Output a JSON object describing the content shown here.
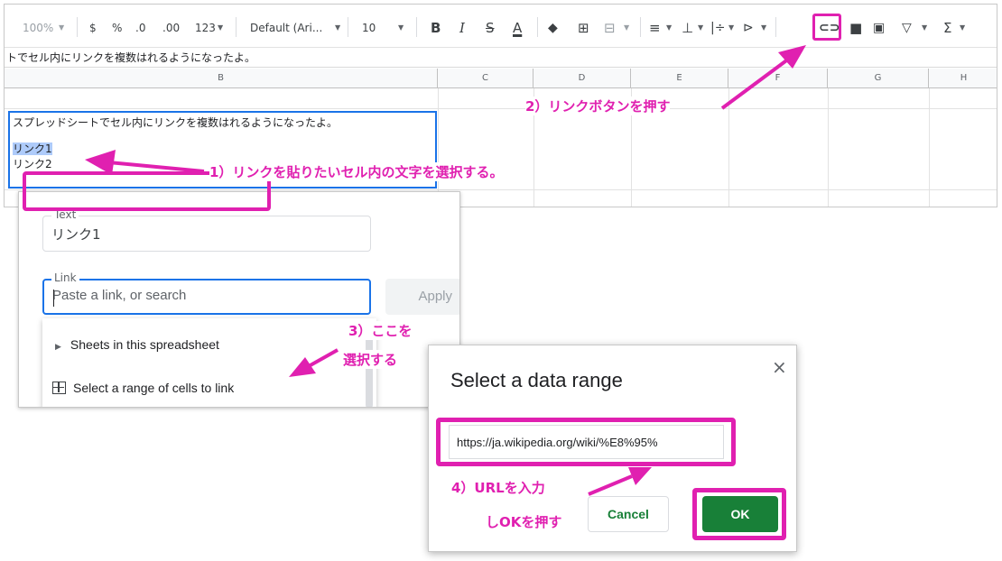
{
  "toolbar": {
    "zoom": "100%",
    "currency": "$",
    "percent": "%",
    "dec_less": ".0",
    "dec_more": ".00",
    "more_formats": "123",
    "font": "Default (Ari...",
    "font_size": "10",
    "bold": "B",
    "italic": "I",
    "strike": "S",
    "textcolor": "A",
    "sigma": "Σ",
    "accent_color": "#e020b0"
  },
  "formula_bar": "トでセル内にリンクを複数はれるようになったよ。",
  "columns": [
    "B",
    "C",
    "D",
    "E",
    "F",
    "G",
    "H"
  ],
  "cell_b": {
    "line1": "スプレッドシートでセル内にリンクを複数はれるようになったよ。",
    "line2": "リンク1",
    "line3": "リンク2"
  },
  "link_dialog": {
    "text_label": "Text",
    "text_value": "リンク1",
    "link_label": "Link",
    "link_placeholder": "Paste a link, or search",
    "apply": "Apply",
    "sheets_item": "Sheets in this spreadsheet",
    "range_item": "Select a range of cells to link"
  },
  "range_dialog": {
    "title": "Select a data range",
    "close": "×",
    "url_value": "https://ja.wikipedia.org/wiki/%E8%95%",
    "cancel": "Cancel",
    "ok": "OK"
  },
  "annotations": {
    "step1": "1）リンクを貼りたいセル内の文字を選択する。",
    "step2": "2）リンクボタンを押す",
    "step3_a": "3）ここを",
    "step3_b": "選択する",
    "step4_a": "4）URLを入力",
    "step4_b": "しOKを押す"
  },
  "icons": [
    "paint-format-icon",
    "borders-icon",
    "merge-icon",
    "align-icon",
    "valign-icon",
    "wrap-icon",
    "rotate-icon",
    "insert-link-icon",
    "insert-comment-icon",
    "insert-chart-icon",
    "filter-icon",
    "functions-icon",
    "chevron-down-icon",
    "grid-icon",
    "close-icon"
  ]
}
